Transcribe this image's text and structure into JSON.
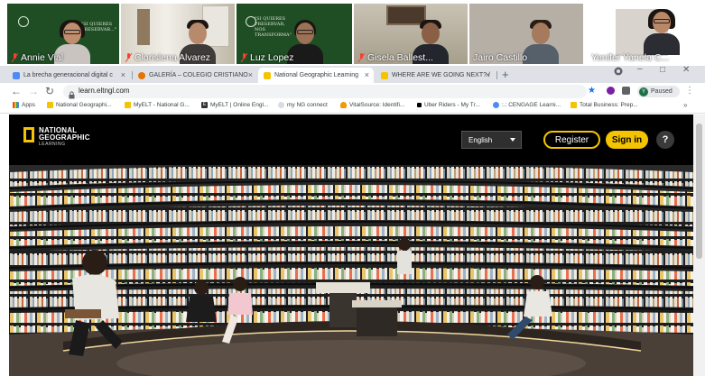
{
  "participants": [
    {
      "name": "Annie Vial"
    },
    {
      "name": "Clorislena Alvarez"
    },
    {
      "name": "Luz Lopez"
    },
    {
      "name": "Gisela Ballest..."
    },
    {
      "name": "Jairo Castillo"
    },
    {
      "name": "Yenifer Yanela C..."
    }
  ],
  "tabs": [
    {
      "label": "La brecha generacional digital c"
    },
    {
      "label": "GALERÍA – COLEGIO CRISTIANO"
    },
    {
      "label": "National Geographic Learning"
    },
    {
      "label": "WHERE ARE WE GOING NEXT? /"
    }
  ],
  "tab_new": "+",
  "address": {
    "url": "learn.eltngl.com"
  },
  "profile": {
    "initial": "Y",
    "status": "Paused"
  },
  "bookmarks": [
    {
      "label": "Apps"
    },
    {
      "label": "National Geographi..."
    },
    {
      "label": "MyELT - National G..."
    },
    {
      "label": "MyELT | Online Engl..."
    },
    {
      "label": "my NG connect"
    },
    {
      "label": "VitalSource: Identifi..."
    },
    {
      "label": "Uber Riders - My Tr..."
    },
    {
      "label": ":.: CENGAGE Learni..."
    },
    {
      "label": "Total Business: Prep..."
    }
  ],
  "site": {
    "logo_line1": "NATIONAL",
    "logo_line2": "GEOGRAPHIC",
    "logo_line3": "LEARNING",
    "language": "English",
    "register_label": "Register",
    "signin_label": "Sign in",
    "help_label": "?"
  },
  "colors": {
    "brand_yellow": "#f5c400",
    "header_bg": "#000000"
  }
}
